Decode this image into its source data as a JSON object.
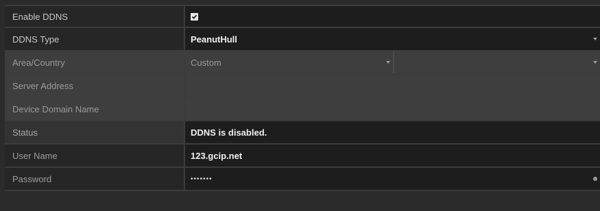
{
  "rows": {
    "enable_ddns": {
      "label": "Enable DDNS",
      "checked": true
    },
    "ddns_type": {
      "label": "DDNS Type",
      "value": "PeanutHull"
    },
    "area_country": {
      "label": "Area/Country",
      "value": "Custom",
      "value2": ""
    },
    "server_address": {
      "label": "Server Address",
      "value": ""
    },
    "device_domain_name": {
      "label": "Device Domain Name",
      "value": ""
    },
    "status": {
      "label": "Status",
      "value": "DDNS is disabled."
    },
    "user_name": {
      "label": "User Name",
      "value": "123.gcip.net"
    },
    "password": {
      "label": "Password",
      "value": "•••••••"
    }
  },
  "icons": {
    "check": "check-icon",
    "caret": "chevron-down-icon",
    "reveal": "eye-icon"
  }
}
